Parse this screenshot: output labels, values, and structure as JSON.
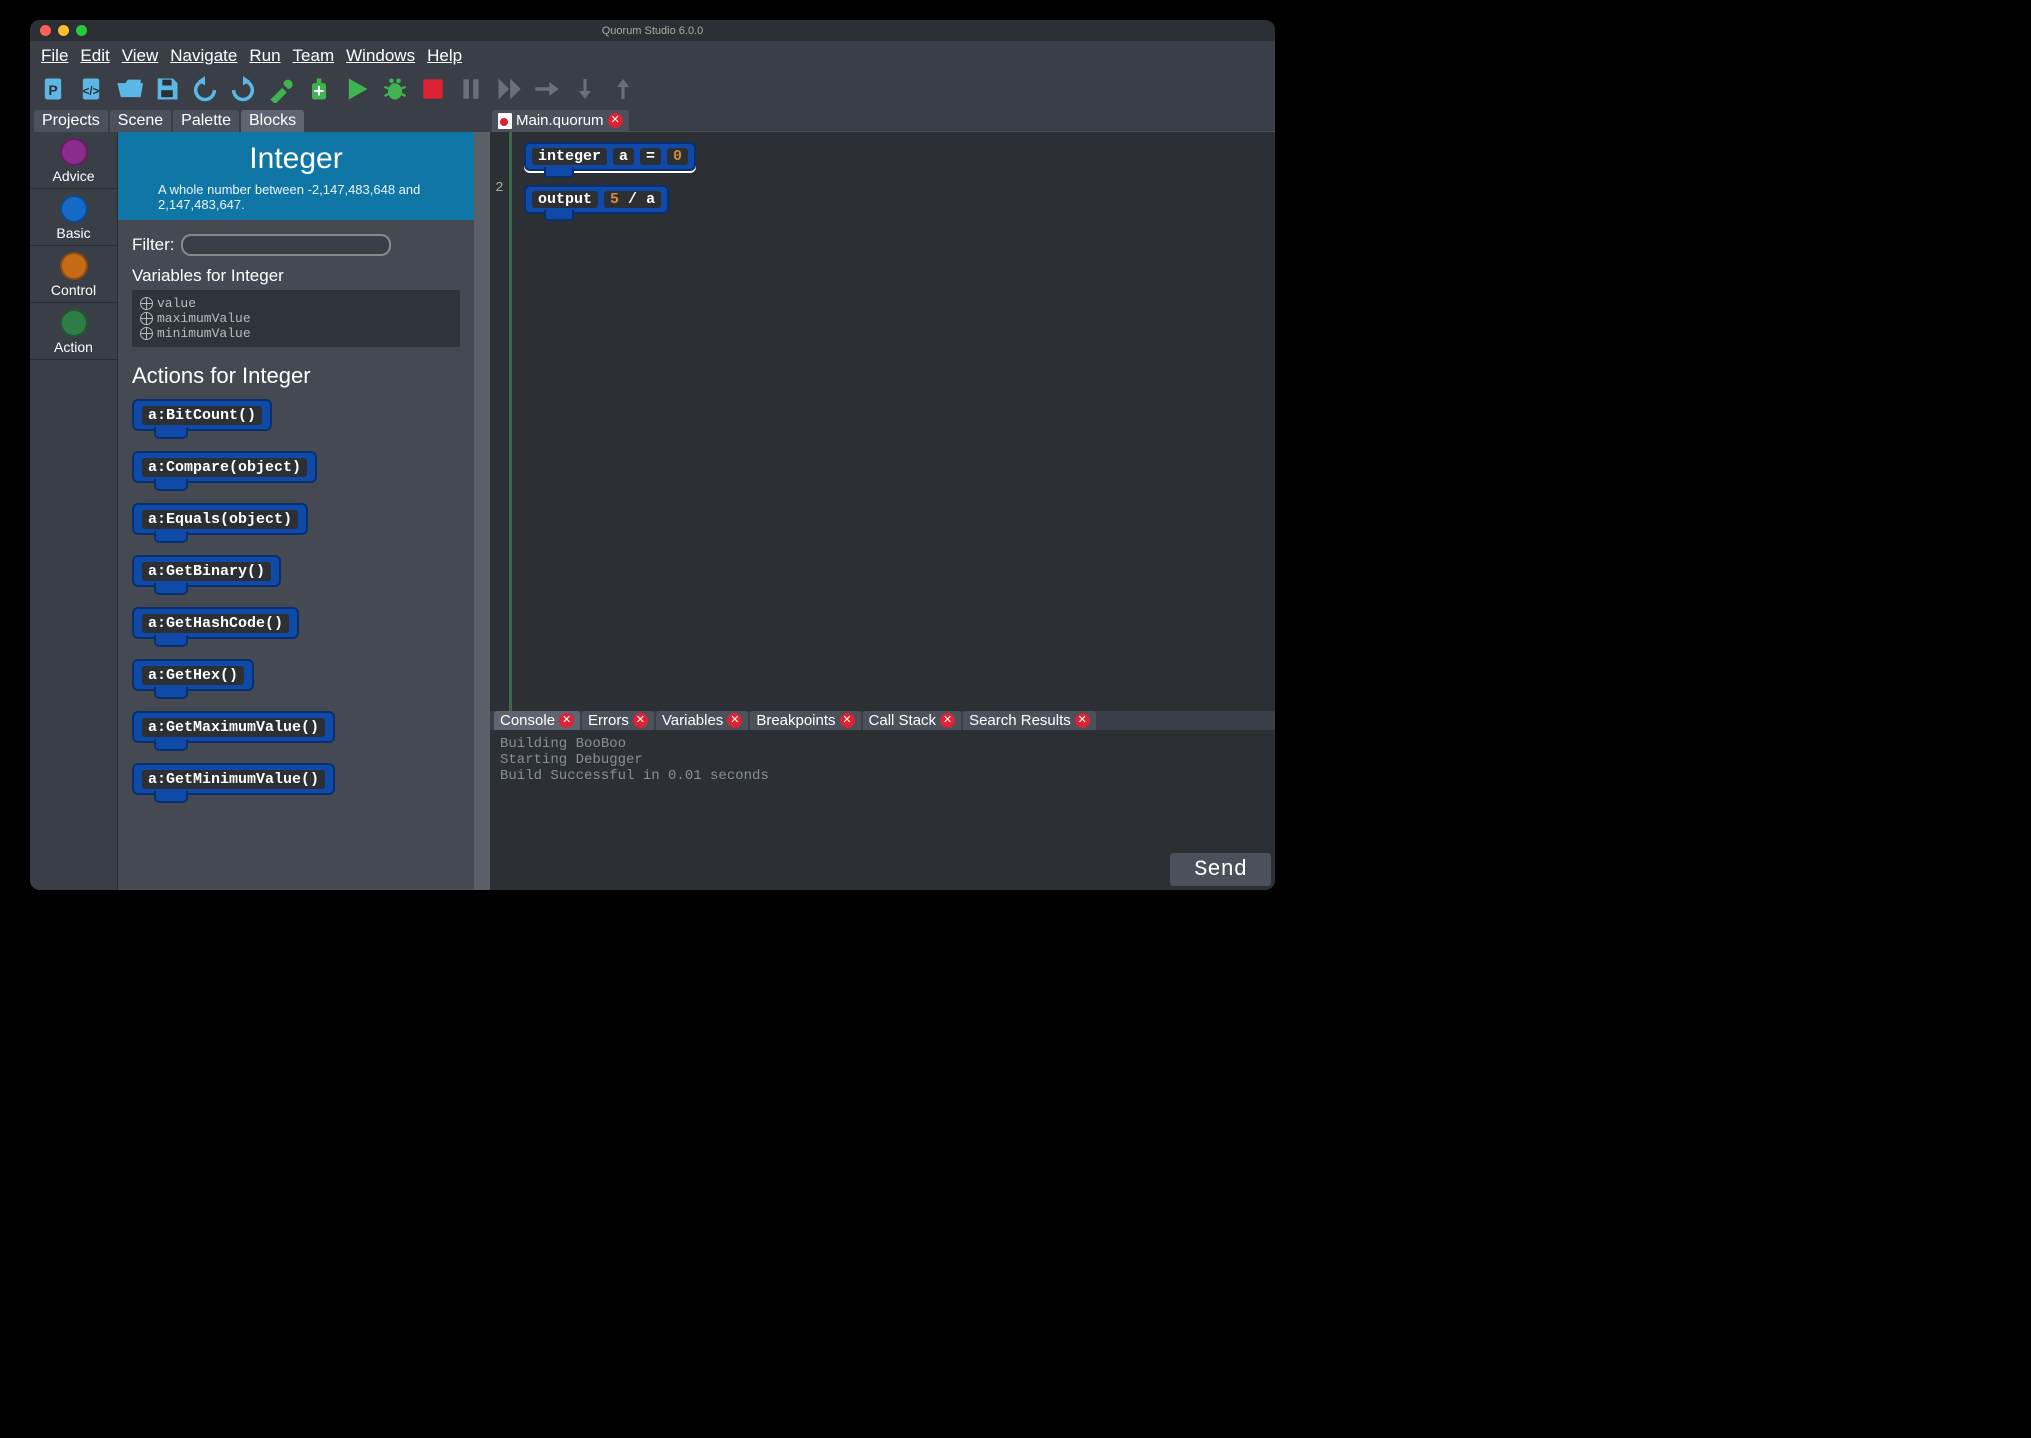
{
  "window": {
    "title": "Quorum Studio 6.0.0"
  },
  "menu": [
    "File",
    "Edit",
    "View",
    "Navigate",
    "Run",
    "Team",
    "Windows",
    "Help"
  ],
  "toolbar_icons": [
    "new-project-icon",
    "new-file-icon",
    "open-icon",
    "save-icon",
    "undo-icon",
    "redo-icon",
    "build-icon",
    "clean-icon",
    "run-icon",
    "debug-icon",
    "stop-icon",
    "pause-icon",
    "step-over-icon",
    "step-into-icon",
    "step-out-icon",
    "continue-icon"
  ],
  "side_tabs": [
    "Projects",
    "Scene",
    "Palette",
    "Blocks"
  ],
  "side_tab_active": "Blocks",
  "categories": [
    {
      "label": "Advice",
      "color": "#8b2b8b"
    },
    {
      "label": "Basic",
      "color": "#1569c7"
    },
    {
      "label": "Control",
      "color": "#c76a15"
    },
    {
      "label": "Action",
      "color": "#2e7d46"
    }
  ],
  "palette": {
    "title": "Integer",
    "subtitle": "A whole number between -2,147,483,648 and 2,147,483,647.",
    "filter_label": "Filter:",
    "variables_title": "Variables for Integer",
    "variables": [
      "value",
      "maximumValue",
      "minimumValue"
    ],
    "actions_title": "Actions for Integer",
    "actions": [
      "a:BitCount()",
      "a:Compare(object)",
      "a:Equals(object)",
      "a:GetBinary()",
      "a:GetHashCode()",
      "a:GetHex()",
      "a:GetMaximumValue()",
      "a:GetMinimumValue()"
    ]
  },
  "editor": {
    "tab_label": "Main.quorum",
    "gutter": "2",
    "line1": {
      "kw": "integer",
      "var": "a",
      "eq": "=",
      "val": "0"
    },
    "line2": {
      "kw": "output",
      "expr_a": "5",
      "expr_op": "/",
      "expr_b": "a"
    }
  },
  "bottom_tabs": [
    "Console",
    "Errors",
    "Variables",
    "Breakpoints",
    "Call Stack",
    "Search Results"
  ],
  "console_lines": [
    "Building BooBoo",
    "Starting Debugger",
    "Build Successful in 0.01 seconds"
  ],
  "send_label": "Send"
}
